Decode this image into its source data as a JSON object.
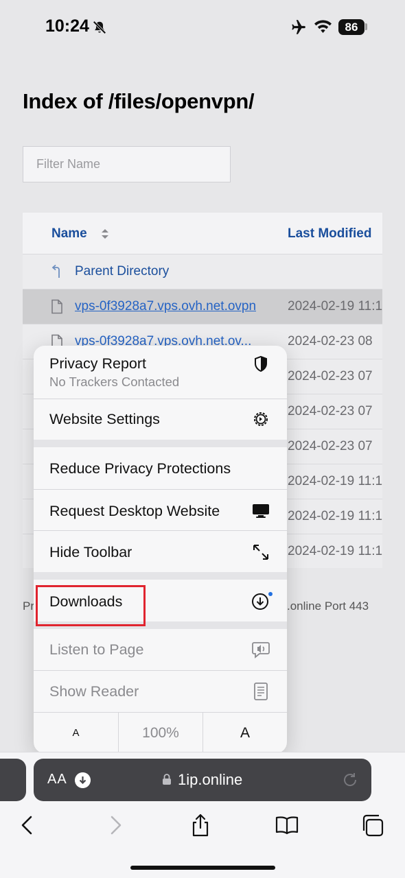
{
  "status_bar": {
    "time": "10:24",
    "battery": "86"
  },
  "page": {
    "title": "Index of /files/openvpn/",
    "filter_placeholder": "Filter Name",
    "columns": {
      "name": "Name",
      "modified": "Last Modified"
    },
    "rows": [
      {
        "name": "Parent Directory",
        "date": ""
      },
      {
        "name": "vps-0f3928a7.vps.ovh.net.ovpn",
        "date": "2024-02-19 11:1"
      },
      {
        "name": "vps-0f3928a7.vps.ovh.net.ov...",
        "date": "2024-02-23 08"
      },
      {
        "name": "",
        "date": "2024-02-23 07"
      },
      {
        "name": "",
        "date": "2024-02-23 07"
      },
      {
        "name": "",
        "date": "2024-02-23 07"
      },
      {
        "name": "",
        "date": "2024-02-19 11:1"
      },
      {
        "name": "",
        "date": "2024-02-19 11:1"
      },
      {
        "name": "",
        "date": "2024-02-19 11:1"
      }
    ],
    "footer_left": "Pr",
    "footer_right": ".online Port 443"
  },
  "menu": {
    "privacy_report": "Privacy Report",
    "privacy_sub": "No Trackers Contacted",
    "website_settings": "Website Settings",
    "reduce_privacy": "Reduce Privacy Protections",
    "request_desktop": "Request Desktop Website",
    "hide_toolbar": "Hide Toolbar",
    "downloads": "Downloads",
    "listen": "Listen to Page",
    "show_reader": "Show Reader",
    "font_smaller": "A",
    "zoom": "100%",
    "font_larger": "A"
  },
  "address_bar": {
    "aa": "AA",
    "domain": "1ip.online"
  },
  "colors": {
    "link": "#1a4e9c",
    "highlight_box": "#e0242f",
    "address_bar": "#434347"
  }
}
